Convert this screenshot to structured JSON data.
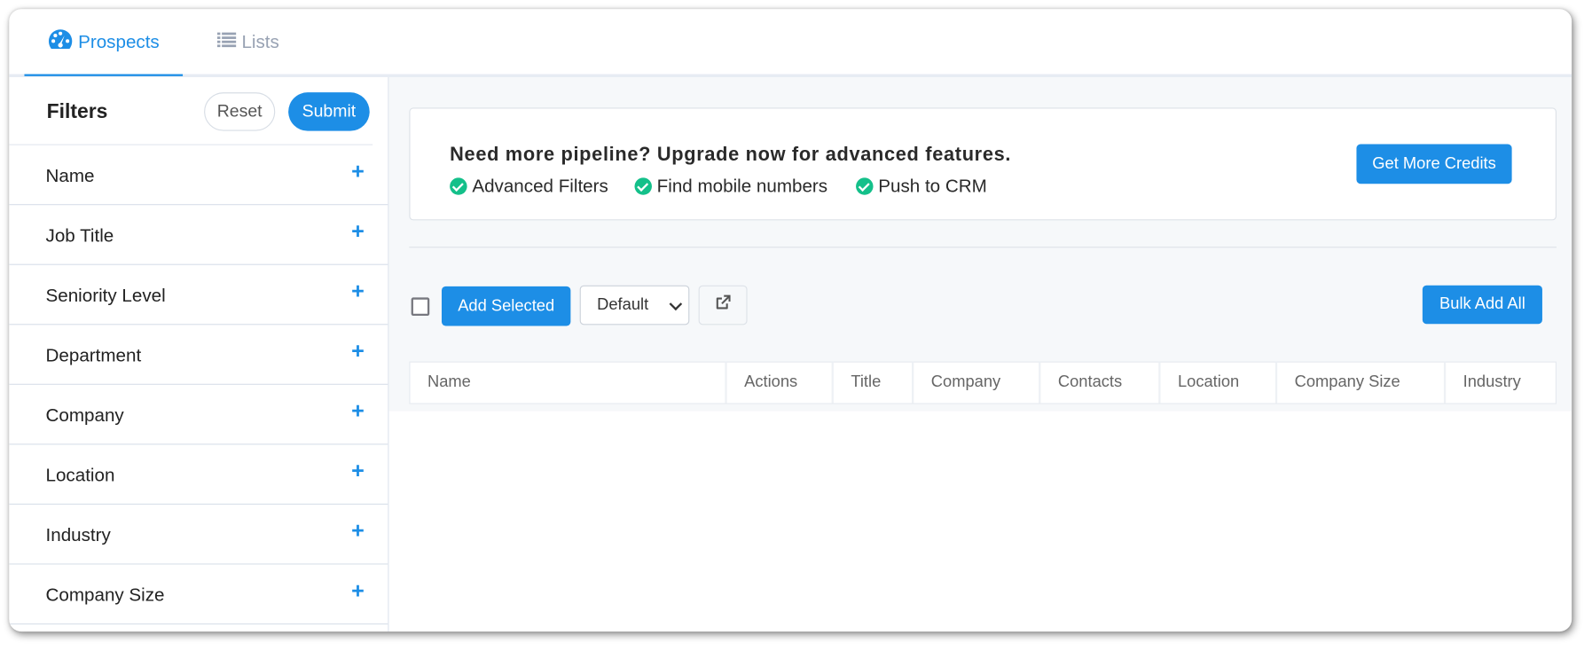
{
  "nav": {
    "tabs": [
      {
        "label": "Prospects",
        "icon": "dashboard-icon",
        "active": true
      },
      {
        "label": "Lists",
        "icon": "list-icon",
        "active": false
      }
    ]
  },
  "filters": {
    "title": "Filters",
    "reset_label": "Reset",
    "submit_label": "Submit",
    "items": [
      {
        "label": "Name",
        "icon": "plus-icon"
      },
      {
        "label": "Job Title",
        "icon": "plus-icon"
      },
      {
        "label": "Seniority Level",
        "icon": "plus-icon"
      },
      {
        "label": "Department",
        "icon": "plus-icon"
      },
      {
        "label": "Company",
        "icon": "plus-icon"
      },
      {
        "label": "Location",
        "icon": "plus-icon"
      },
      {
        "label": "Industry",
        "icon": "plus-icon"
      },
      {
        "label": "Company Size",
        "icon": "plus-icon"
      }
    ]
  },
  "banner": {
    "title": "Need more pipeline? Upgrade now for advanced features.",
    "features": [
      "Advanced Filters",
      "Find mobile numbers",
      "Push to CRM"
    ],
    "cta_label": "Get More Credits"
  },
  "toolbar": {
    "add_selected_label": "Add Selected",
    "list_select_value": "Default",
    "external_link_icon": "external-link-icon",
    "bulk_add_label": "Bulk Add All"
  },
  "table": {
    "columns": [
      "Name",
      "Actions",
      "Title",
      "Company",
      "Contacts",
      "Location",
      "Company Size",
      "Industry"
    ]
  },
  "colors": {
    "accent": "#1d8ee6",
    "check": "#14c08a",
    "muted_tab": "#98a2b3"
  }
}
